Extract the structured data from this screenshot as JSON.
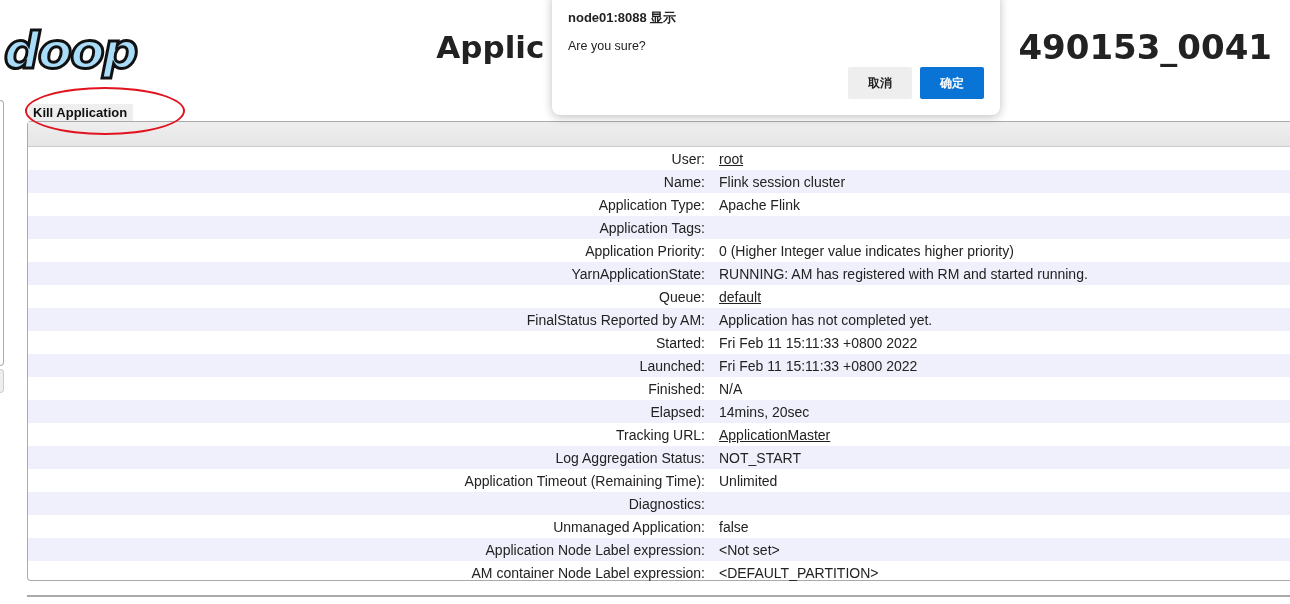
{
  "logo": {
    "text": "doop"
  },
  "title": {
    "visible_start": "Applic",
    "visible_end": "490153_0041"
  },
  "kill_button": {
    "label": "Kill Application",
    "circled": true
  },
  "details": [
    {
      "label": "User:",
      "value": "root",
      "link": true
    },
    {
      "label": "Name:",
      "value": "Flink session cluster",
      "link": false
    },
    {
      "label": "Application Type:",
      "value": "Apache Flink",
      "link": false
    },
    {
      "label": "Application Tags:"
    },
    {
      "label": "Application Priority:",
      "value": "0 (Higher Integer value indicates higher priority)",
      "link": false
    },
    {
      "label": "YarnApplicationState:",
      "value": "RUNNING: AM has registered with RM and started running.",
      "link": false
    },
    {
      "label": "Queue:",
      "value": "default",
      "link": true
    },
    {
      "label": "FinalStatus Reported by AM:",
      "value": "Application has not completed yet.",
      "link": false
    },
    {
      "label": "Started:",
      "value": "Fri Feb 11 15:11:33 +0800 2022",
      "link": false
    },
    {
      "label": "Launched:",
      "value": "Fri Feb 11 15:11:33 +0800 2022",
      "link": false
    },
    {
      "label": "Finished:",
      "value": "N/A",
      "link": false
    },
    {
      "label": "Elapsed:",
      "value": "14mins, 20sec",
      "link": false
    },
    {
      "label": "Tracking URL:",
      "value": "ApplicationMaster",
      "link": true
    },
    {
      "label": "Log Aggregation Status:",
      "value": "NOT_START",
      "link": false
    },
    {
      "label": "Application Timeout (Remaining Time):",
      "value": "Unlimited",
      "link": false
    },
    {
      "label": "Diagnostics:"
    },
    {
      "label": "Unmanaged Application:",
      "value": "false",
      "link": false
    },
    {
      "label": "Application Node Label expression:",
      "value": "<Not set>",
      "link": false
    },
    {
      "label": "AM container Node Label expression:",
      "value": "<DEFAULT_PARTITION>",
      "link": false
    }
  ],
  "dialog": {
    "title": "node01:8088 显示",
    "message": "Are you sure?",
    "buttons": [
      {
        "label": "取消",
        "kind": "cancel"
      },
      {
        "label": "确定",
        "kind": "primary"
      }
    ]
  }
}
